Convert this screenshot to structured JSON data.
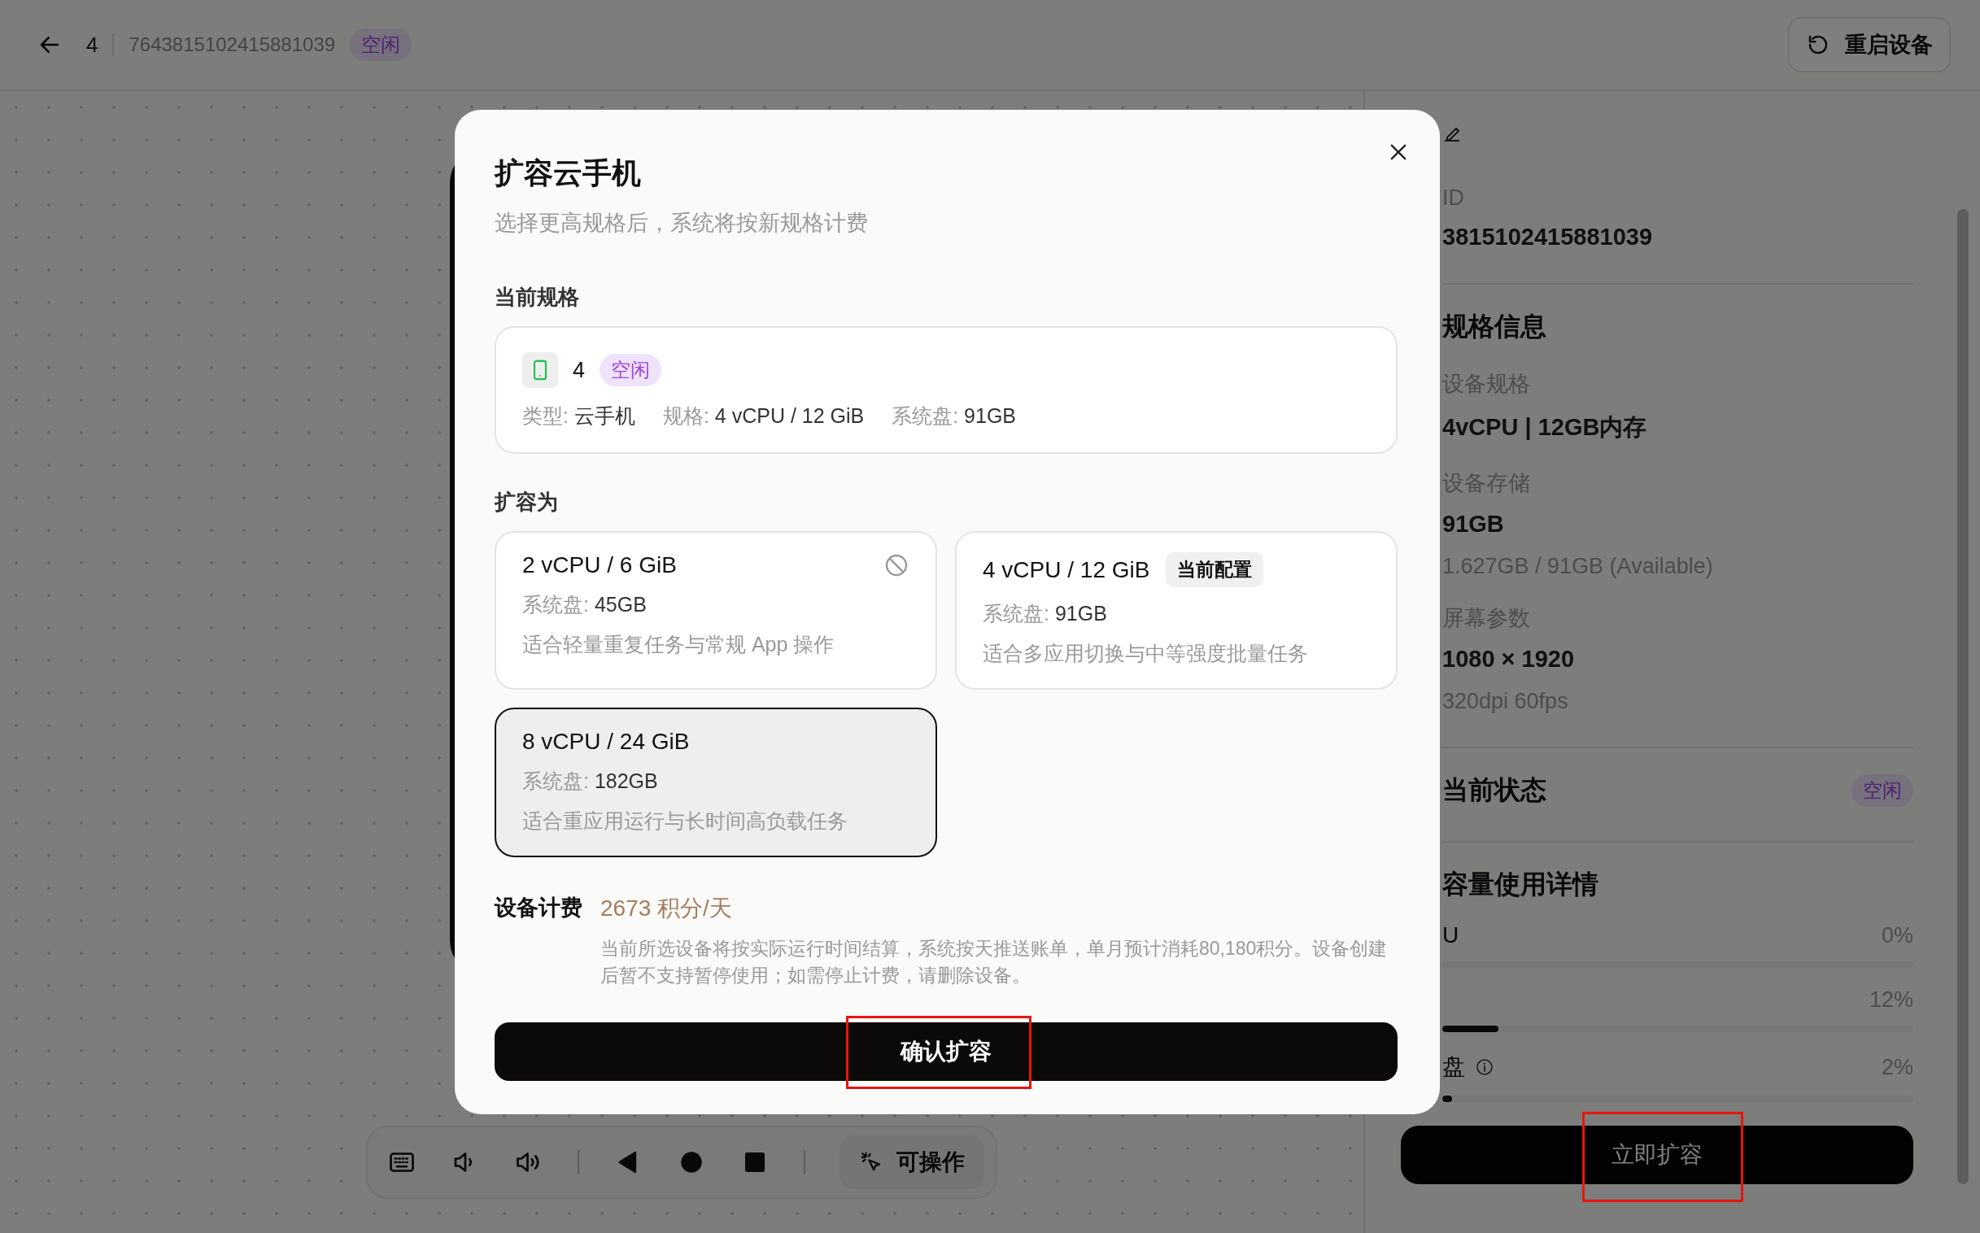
{
  "header": {
    "device_name": "4",
    "device_id": "7643815102415881039",
    "status": "空闲",
    "restart_button": "重启设备"
  },
  "right_panel": {
    "id_label": "ID",
    "id_value": "3815102415881039",
    "spec_title": "规格信息",
    "fields": [
      {
        "label": "设备规格",
        "value": "4vCPU | 12GB内存"
      },
      {
        "label": "设备存储",
        "value": "91GB",
        "note": "1.627GB / 91GB (Available)"
      },
      {
        "label": "屏幕参数",
        "value": "1080 × 1920",
        "note": "320dpi 60fps"
      }
    ],
    "status_title": "当前状态",
    "status": "空闲",
    "usage_title": "容量使用详情",
    "usage": [
      {
        "label": "U",
        "reading": "0%",
        "info": false
      },
      {
        "reading": "12%",
        "level": 0.12,
        "info": false
      },
      {
        "label": "盘",
        "reading": "2%",
        "level": 0.02,
        "info": true
      }
    ],
    "expand_button": "立即扩容"
  },
  "toolbar": {
    "items": [
      {
        "kind": "keyboard"
      },
      {
        "kind": "volume-down"
      },
      {
        "kind": "volume-up"
      },
      {
        "kind": "divider"
      },
      {
        "kind": "back"
      },
      {
        "kind": "home"
      },
      {
        "kind": "recent"
      },
      {
        "kind": "divider"
      }
    ],
    "mode_button": "可操作"
  },
  "modal": {
    "title": "扩容云手机",
    "subtitle": "选择更高规格后，系统将按新规格计费",
    "current_label": "当前规格",
    "current": {
      "name": "4",
      "status": "空闲",
      "specs": [
        {
          "label": "类型:",
          "value": "云手机"
        },
        {
          "label": "规格:",
          "value": "4 vCPU / 12 GiB"
        },
        {
          "label": "系统盘:",
          "value": "91GB"
        }
      ]
    },
    "target_label": "扩容为",
    "options": [
      {
        "name": "2 vCPU / 6 GiB",
        "disk_label": "系统盘:",
        "disk": "45GB",
        "description": "适合轻量重复任务与常规 App 操作",
        "selected": false,
        "disabled": true
      },
      {
        "name": "4 vCPU / 12 GiB",
        "tag": "当前配置",
        "disk_label": "系统盘:",
        "disk": "91GB",
        "description": "适合多应用切换与中等强度批量任务",
        "selected": false,
        "disabled": false
      },
      {
        "name": "8 vCPU / 24 GiB",
        "disk_label": "系统盘:",
        "disk": "182GB",
        "description": "适合重应用运行与长时间高负载任务",
        "selected": true,
        "disabled": false
      }
    ],
    "billing_label": "设备计费",
    "price": "2673 积分/天",
    "billing_note": "当前所选设备将按实际运行时间结算，系统按天推送账单，单月预计消耗80,180积分。设备创建后暂不支持暂停使用；如需停止计费，请删除设备。",
    "confirm_button": "确认扩容"
  }
}
